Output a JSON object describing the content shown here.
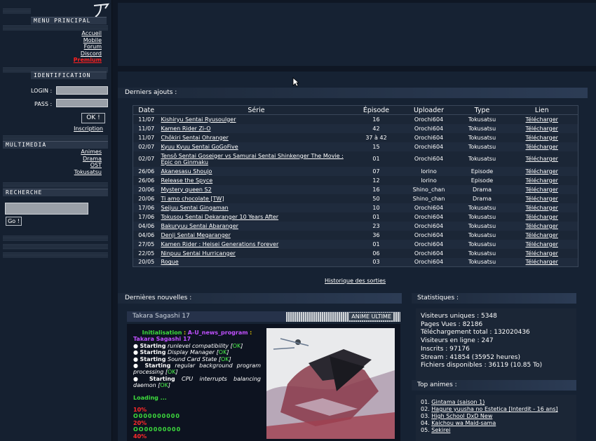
{
  "sidebar": {
    "menu_title": "MENU PRINCIPAL",
    "menu_links": [
      "Accueil",
      "Mobile",
      "Forum",
      "Discord",
      "Premium"
    ],
    "ident_title": "IDENTIFICATION",
    "login_label": "LOGIN :",
    "pass_label": "PASS :",
    "ok_label": "OK !",
    "inscription": "Inscription",
    "multimedia_title": "MULTIMEDIA",
    "multimedia_links": [
      "Animes",
      "Drama",
      "OST",
      "Tokusatsu"
    ],
    "recherche_title": "RECHERCHE",
    "go_label": "Go !"
  },
  "main": {
    "derniers_ajouts": "Derniers ajouts :",
    "columns": [
      "Date",
      "Série",
      "Épisode",
      "Uploader",
      "Type",
      "Lien"
    ],
    "rows": [
      {
        "date": "11/07",
        "serie": "Kishiryu Sentai Ryusoulger",
        "episode": "16",
        "uploader": "Orochi604",
        "type": "Tokusatsu",
        "lien": "Télécharger"
      },
      {
        "date": "11/07",
        "serie": "Kamen Rider Zi-O",
        "episode": "42",
        "uploader": "Orochi604",
        "type": "Tokusatsu",
        "lien": "Télécharger"
      },
      {
        "date": "11/07",
        "serie": "Chôkiri Sentai Ohranger",
        "episode": "37 à 42",
        "uploader": "Orochi604",
        "type": "Tokusatsu",
        "lien": "Télécharger"
      },
      {
        "date": "02/07",
        "serie": "Kyuu Kyuu Sentai GoGoFive",
        "episode": "15",
        "uploader": "Orochi604",
        "type": "Tokusatsu",
        "lien": "Télécharger"
      },
      {
        "date": "02/07",
        "serie": "Tensô Sentai Goseiger vs Samurai Sentai Shinkenger The Movie : Epic on Ginmaku",
        "episode": "01",
        "uploader": "Orochi604",
        "type": "Tokusatsu",
        "lien": "Télécharger"
      },
      {
        "date": "26/06",
        "serie": "Akanesasu Shoujo",
        "episode": "07",
        "uploader": "lorino",
        "type": "Episode",
        "lien": "Télécharger"
      },
      {
        "date": "26/06",
        "serie": "Release the Spyce",
        "episode": "12",
        "uploader": "lorino",
        "type": "Episode",
        "lien": "Télécharger"
      },
      {
        "date": "20/06",
        "serie": "Mystery queen S2",
        "episode": "16",
        "uploader": "Shino_chan",
        "type": "Drama",
        "lien": "Télécharger"
      },
      {
        "date": "20/06",
        "serie": "Ti amo chocolate [TW]",
        "episode": "50",
        "uploader": "Shino_chan",
        "type": "Drama",
        "lien": "Télécharger"
      },
      {
        "date": "17/06",
        "serie": "Seijuu Sentai Gingaman",
        "episode": "10",
        "uploader": "Orochi604",
        "type": "Tokusatsu",
        "lien": "Télécharger"
      },
      {
        "date": "17/06",
        "serie": "Tokusou Sentai Dekaranger 10 Years After",
        "episode": "01",
        "uploader": "Orochi604",
        "type": "Tokusatsu",
        "lien": "Télécharger"
      },
      {
        "date": "04/06",
        "serie": "Bakuryuu Sentai Abaranger",
        "episode": "23",
        "uploader": "Orochi604",
        "type": "Tokusatsu",
        "lien": "Télécharger"
      },
      {
        "date": "04/06",
        "serie": "Denji Sentai Megaranger",
        "episode": "36",
        "uploader": "Orochi604",
        "type": "Tokusatsu",
        "lien": "Télécharger"
      },
      {
        "date": "27/05",
        "serie": "Kamen Rider : Heisei Generations Forever",
        "episode": "01",
        "uploader": "Orochi604",
        "type": "Tokusatsu",
        "lien": "Télécharger"
      },
      {
        "date": "22/05",
        "serie": "Ninpuu Sentai Hurricanger",
        "episode": "06",
        "uploader": "Orochi604",
        "type": "Tokusatsu",
        "lien": "Télécharger"
      },
      {
        "date": "20/05",
        "serie": "Rogue",
        "episode": "03",
        "uploader": "Orochi604",
        "type": "Tokusatsu",
        "lien": "Télécharger"
      }
    ],
    "historique": "Historique des sorties",
    "dernieres_nouvelles": "Dernières nouvelles :",
    "news_title": "Takara Sagashi 17",
    "news_badge": "ANIME ULTIME",
    "console": {
      "init": "Initialisation",
      "colon": ":",
      "program": "A-U_news_program",
      "name": "Takara Sagashi 17",
      "lines": [
        {
          "bold": "Starting",
          "text": "runlevel compatibility",
          "ok": "OK"
        },
        {
          "bold": "Starting",
          "text": "Display Manager",
          "ok": "OK"
        },
        {
          "bold": "Starting",
          "text": "Sound Card State",
          "ok": "OK"
        },
        {
          "bold": "Starting",
          "text": "regular background program processing",
          "ok": "OK"
        },
        {
          "bold": "Starting",
          "text": "CPU interrupts balancing daemon",
          "ok": "OK"
        }
      ],
      "loading": "Loading ...",
      "p10": "10%",
      "bar1": "O000000000",
      "p20": "20%",
      "bar2": "OO00000000",
      "p40": "40%"
    },
    "statistiques": "Statistiques :",
    "stats": [
      "Visiteurs uniques : 5348",
      "Pages Vues : 82186",
      "Téléchargement total : 132020436",
      "Visiteurs en ligne : 247",
      "Inscrits : 97176",
      "Stream : 41854 (35952 heures)",
      "Fichiers disponibles : 36119 (10.85 To)"
    ],
    "top_animes": "Top animes :",
    "top": [
      {
        "rank": "01.",
        "title": "Gintama (saison 1)"
      },
      {
        "rank": "02.",
        "title": "Hagure yuusha no Estetica [Interdit - 16 ans]"
      },
      {
        "rank": "03.",
        "title": "High School DxD New"
      },
      {
        "rank": "04.",
        "title": "Kaichou wa Maid-sama"
      },
      {
        "rank": "05.",
        "title": "Sekirei"
      }
    ]
  },
  "colors": {
    "page_bg": "#0f1724",
    "panel_bg": "#162233",
    "ok_green": "#4cf04c",
    "premium_red": "#ff2020"
  }
}
